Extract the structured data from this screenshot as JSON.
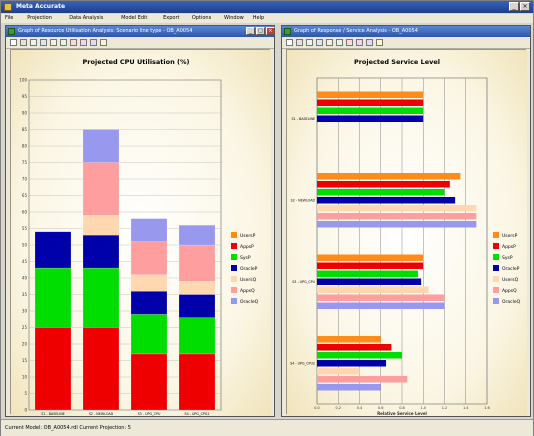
{
  "app": {
    "title": "Meta Accurate"
  },
  "menu": [
    "File",
    "Projection",
    "Data Analysis",
    "Model Edit",
    "Export",
    "Options",
    "Window",
    "Help"
  ],
  "colors": {
    "UsersP": "#ff8c1a",
    "AppsP": "#ee0000",
    "SysP": "#00dd00",
    "OracleP": "#0000aa",
    "UsersQ": "#ffd7b0",
    "AppsQ": "#ff9e9e",
    "OracleQ": "#9898ee"
  },
  "left_window": {
    "title": "Graph of Resource Utilisation Analysis: Scenario line type - OB_A0054",
    "toolbar_icons": [
      "print-icon",
      "copy-icon",
      "bar-chart-icon",
      "line-chart-icon",
      "grid-icon",
      "zoom-icon",
      "export-icon",
      "palette-icon",
      "settings-icon",
      "help-icon"
    ]
  },
  "right_window": {
    "title": "Graph of Response / Service Analysis - OB_A0054",
    "toolbar_icons": [
      "print-icon",
      "copy-icon",
      "bar-chart-icon",
      "line-chart-icon",
      "grid-icon",
      "zoom-icon",
      "export-icon",
      "palette-icon",
      "settings-icon",
      "help-icon"
    ]
  },
  "status": {
    "text": "Current Model: OB_A0054.rdl   Current Projection: 5"
  },
  "chart_data": [
    {
      "type": "bar",
      "stacked": true,
      "title": "Projected CPU Utilisation (%)",
      "categories": [
        "S1 - BASELINE",
        "S2 - NEWLOAD",
        "S3 - UPG_CPU",
        "S4 - UPG_CPU2"
      ],
      "series": [
        {
          "name": "AppsP",
          "values": [
            25,
            25,
            17,
            17
          ]
        },
        {
          "name": "SysP",
          "values": [
            18,
            18,
            12,
            11
          ]
        },
        {
          "name": "OracleP",
          "values": [
            11,
            10,
            7,
            7
          ]
        },
        {
          "name": "UsersQ",
          "values": [
            0,
            6,
            5,
            4
          ]
        },
        {
          "name": "AppsQ",
          "values": [
            0,
            16,
            10,
            11
          ]
        },
        {
          "name": "OracleQ",
          "values": [
            0,
            10,
            7,
            6
          ]
        }
      ],
      "legend": [
        "UsersP",
        "AppsP",
        "SysP",
        "OracleP",
        "UsersQ",
        "AppsQ",
        "OracleQ"
      ],
      "yticks": [
        0,
        5,
        10,
        15,
        20,
        25,
        30,
        35,
        40,
        45,
        50,
        55,
        60,
        65,
        70,
        75,
        80,
        85,
        90,
        95,
        100
      ],
      "ylim": [
        0,
        100
      ],
      "grid": true,
      "legend_position": "right"
    },
    {
      "type": "bar",
      "orientation": "horizontal",
      "title": "Projected Service Level",
      "categories": [
        "S1 - BASELINE",
        "S2 - NEWLOAD",
        "S3 - UPG_CPU",
        "S4 - UPG_CPU2"
      ],
      "series": [
        {
          "name": "UsersP",
          "values": [
            1.0,
            1.35,
            1.0,
            0.6
          ]
        },
        {
          "name": "AppsP",
          "values": [
            1.0,
            1.25,
            1.0,
            0.7
          ]
        },
        {
          "name": "SysP",
          "values": [
            1.0,
            1.2,
            0.95,
            0.8
          ]
        },
        {
          "name": "OracleP",
          "values": [
            1.0,
            1.3,
            0.98,
            0.65
          ]
        },
        {
          "name": "UsersQ",
          "values": [
            0.0,
            1.5,
            1.05,
            0.4
          ]
        },
        {
          "name": "AppsQ",
          "values": [
            0.0,
            1.5,
            1.2,
            0.85
          ]
        },
        {
          "name": "OracleQ",
          "values": [
            0.0,
            1.5,
            1.2,
            0.6
          ]
        }
      ],
      "xticks": [
        "0.0",
        "0.2",
        "0.4",
        "0.6",
        "0.8",
        "1.0",
        "1.2",
        "1.4",
        "1.6"
      ],
      "xlim": [
        0,
        1.6
      ],
      "xlabel": "Relative Service Level",
      "grid": true,
      "legend_position": "right"
    }
  ]
}
